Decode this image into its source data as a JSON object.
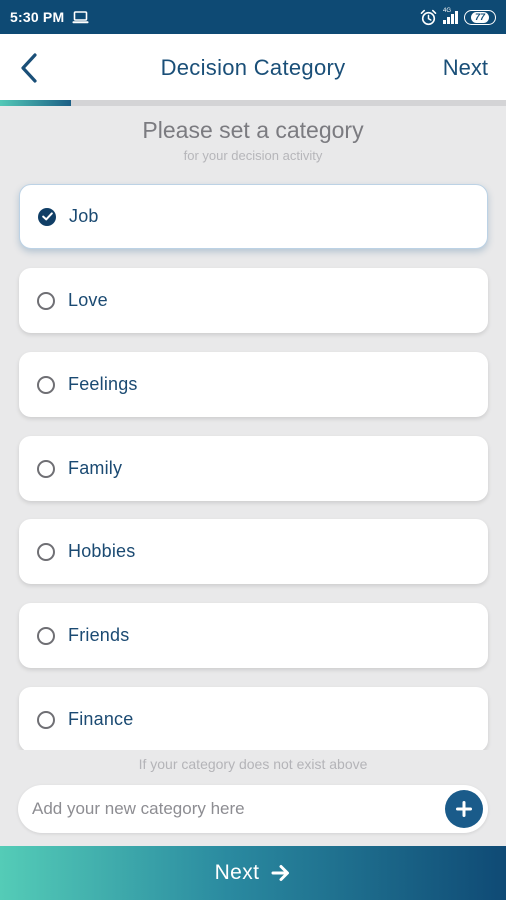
{
  "status_bar": {
    "time": "5:30 PM",
    "network_label": "4G",
    "battery_level": "77",
    "icons": [
      "laptop-icon",
      "alarm-icon",
      "signal-icon",
      "battery-icon"
    ]
  },
  "header": {
    "back_icon": "chevron-left-icon",
    "title": "Decision Category",
    "next_label": "Next"
  },
  "progress": {
    "value_percent": 14
  },
  "prompt": {
    "title": "Please set a category",
    "subtitle": "for your decision activity"
  },
  "categories": [
    {
      "label": "Job",
      "selected": true
    },
    {
      "label": "Love",
      "selected": false
    },
    {
      "label": "Feelings",
      "selected": false
    },
    {
      "label": "Family",
      "selected": false
    },
    {
      "label": "Hobbies",
      "selected": false
    },
    {
      "label": "Friends",
      "selected": false
    },
    {
      "label": "Finance",
      "selected": false
    }
  ],
  "add_category": {
    "helper_text": "If your category does not exist above",
    "placeholder": "Add your new category here",
    "add_icon": "plus-icon"
  },
  "footer": {
    "next_label": "Next",
    "next_icon": "arrow-right-icon"
  },
  "colors": {
    "primary": "#0e4a74",
    "accent_gradient_start": "#54ccb7",
    "text_primary": "#1b4a72",
    "background": "#e9e9ea"
  }
}
